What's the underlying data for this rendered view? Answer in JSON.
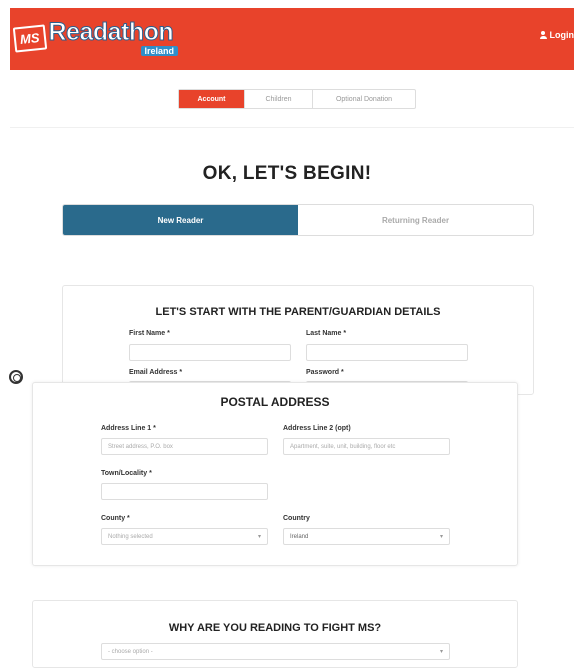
{
  "header": {
    "logo_ms": "MS",
    "logo_main": "Readathon",
    "logo_sub": "Ireland",
    "login_label": "Login",
    "bg_color": "#e8432b"
  },
  "steps": [
    {
      "label": "Account",
      "active": true
    },
    {
      "label": "Children",
      "active": false
    },
    {
      "label": "Optional Donation",
      "active": false
    }
  ],
  "page_title": "OK, LET'S BEGIN!",
  "reader_toggle": {
    "new_label": "New Reader",
    "returning_label": "Returning Reader",
    "active_color": "#2a6a8c"
  },
  "parent_section": {
    "title": "LET'S START WITH THE PARENT/GUARDIAN DETAILS",
    "first_name_label": "First Name *",
    "last_name_label": "Last Name *",
    "email_label": "Email Address *",
    "password_label": "Password *"
  },
  "postal_section": {
    "title": "POSTAL ADDRESS",
    "address1_label": "Address Line 1 *",
    "address1_placeholder": "Street address, P.O. box",
    "address2_label": "Address Line 2 (opt)",
    "address2_placeholder": "Apartment, suite, unit, building, floor etc",
    "town_label": "Town/Locality *",
    "county_label": "County *",
    "county_value": "Nothing selected",
    "country_label": "Country",
    "country_value": "Ireland"
  },
  "why_section": {
    "title": "WHY ARE YOU READING TO FIGHT MS?",
    "select_value": "- choose option -"
  }
}
